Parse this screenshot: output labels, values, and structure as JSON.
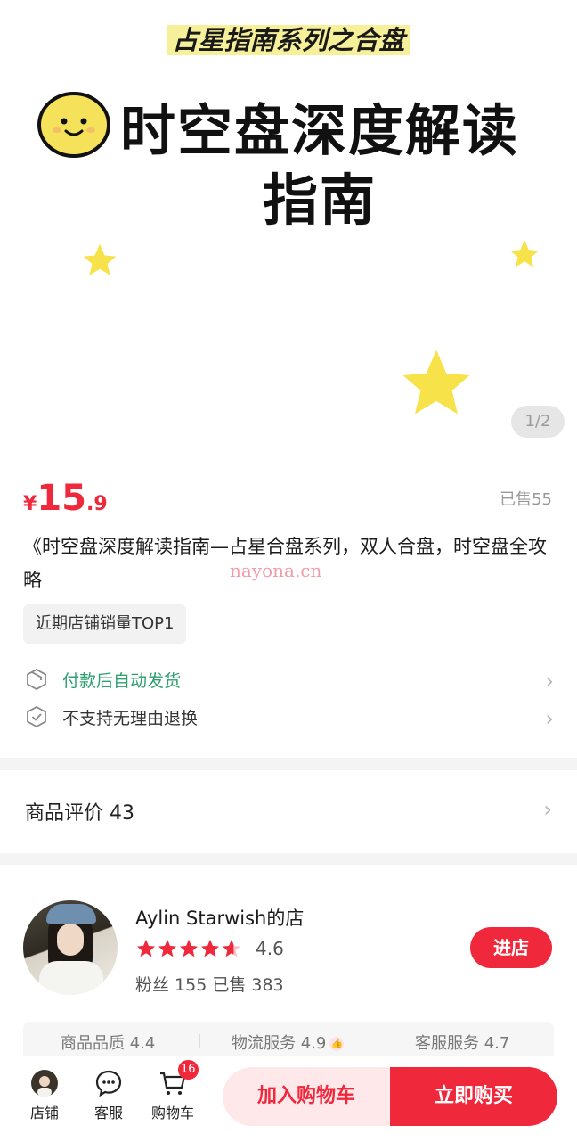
{
  "banner": {
    "series_title": "占星指南系列之合盘",
    "headline_line1": "时空盘深度解读",
    "headline_line2": "指南",
    "image_counter": "1/2"
  },
  "product": {
    "currency": "¥",
    "price_int": "15",
    "price_dec": ".9",
    "sold": "已售55",
    "title": "《时空盘深度解读指南—占星合盘系列，双人合盘，时空盘全攻略",
    "watermark": "nayona.cn",
    "tag": "近期店铺销量TOP1",
    "services": [
      {
        "text": "付款后自动发货",
        "icon": "package-icon"
      },
      {
        "text": "不支持无理由退换",
        "icon": "shield-check-icon"
      }
    ]
  },
  "reviews": {
    "label": "商品评价 43"
  },
  "shop": {
    "name": "Aylin Starwish的店",
    "rating": "4.6",
    "rating_value": 4.6,
    "meta": "粉丝 155  已售 383",
    "enter_label": "进店",
    "scores": [
      "商品品质 4.4",
      "物流服务 4.9",
      "客服服务 4.7"
    ]
  },
  "bottom_bar": {
    "nav": [
      {
        "label": "店铺",
        "icon": "shop-avatar-icon"
      },
      {
        "label": "客服",
        "icon": "chat-icon"
      },
      {
        "label": "购物车",
        "icon": "cart-icon",
        "badge": "16"
      }
    ],
    "add_to_cart": "加入购物车",
    "buy_now": "立即购买"
  },
  "colors": {
    "accent": "#f0283c",
    "green": "#2e9f6e",
    "star": "#f7e24a"
  }
}
